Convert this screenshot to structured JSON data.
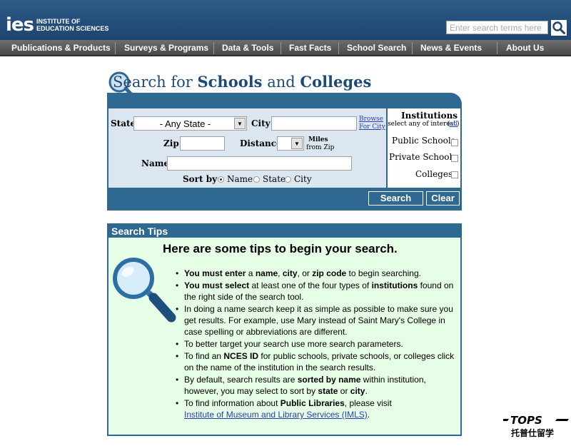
{
  "header": {
    "logo_mark": "ies",
    "logo_line1": "INSTITUTE of",
    "logo_line2": "EDUCATION SCIENCES",
    "search_placeholder": "Enter search terms here"
  },
  "nav": {
    "items": [
      {
        "label": "Publications & Products"
      },
      {
        "label": "Surveys & Programs"
      },
      {
        "label": "Data & Tools"
      },
      {
        "label": "Fast Facts"
      },
      {
        "label": "School Search"
      },
      {
        "label": "News & Events"
      },
      {
        "label": "About Us"
      }
    ]
  },
  "title": {
    "part1": "Search for ",
    "part2": "Schools",
    "part3": " and ",
    "part4": "Colleges"
  },
  "form": {
    "state_label": "State",
    "state_value": "- Any State -",
    "city_label": "City",
    "browse_line1": "Browse",
    "browse_line2": "For City",
    "zip_label": "Zip",
    "distance_label": "Distance",
    "miles_line1": "Miles",
    "miles_line2": "from Zip",
    "name_label": "Name",
    "sortby_label": "Sort by",
    "sort_options": [
      "Name",
      "State",
      "City"
    ],
    "sort_selected": "Name"
  },
  "institutions": {
    "title": "Institutions",
    "subtitle": "select any of interest",
    "all_link": "all",
    "options": [
      "Public Schools",
      "Private Schools",
      "Colleges"
    ]
  },
  "buttons": {
    "search": "Search",
    "clear": "Clear"
  },
  "tips": {
    "header": "Search Tips",
    "title": "Here are some tips to begin your search.",
    "items": [
      {
        "parts": [
          [
            "b",
            "You must enter"
          ],
          [
            "t",
            " a "
          ],
          [
            "b",
            "name"
          ],
          [
            "t",
            ", "
          ],
          [
            "b",
            "city"
          ],
          [
            "t",
            ", or "
          ],
          [
            "b",
            "zip code"
          ],
          [
            "t",
            " to begin searching."
          ]
        ]
      },
      {
        "parts": [
          [
            "b",
            "You must select"
          ],
          [
            "t",
            " at least one of the four types of "
          ],
          [
            "b",
            "institutions"
          ],
          [
            "t",
            " found on the right side of the search tool."
          ]
        ]
      },
      {
        "parts": [
          [
            "t",
            "In doing a name search keep it as simple as possible to make sure you get results. For example, use Mary instead of Saint Mary's College in case spelling or abbreviations are different."
          ]
        ]
      },
      {
        "parts": [
          [
            "t",
            "To better target your search use more search parameters."
          ]
        ]
      },
      {
        "parts": [
          [
            "t",
            "To find an "
          ],
          [
            "b",
            "NCES ID"
          ],
          [
            "t",
            " for public schools, private schools, or colleges click on the name of the institution in the search results."
          ]
        ]
      },
      {
        "parts": [
          [
            "t",
            "By default, search results are "
          ],
          [
            "b",
            "sorted by name"
          ],
          [
            "t",
            " within institution, however, you may select to sort by "
          ],
          [
            "b",
            "state"
          ],
          [
            "t",
            " or "
          ],
          [
            "b",
            "city"
          ],
          [
            "t",
            "."
          ]
        ]
      },
      {
        "parts": [
          [
            "t",
            "To find information about "
          ],
          [
            "b",
            "Public Libraries"
          ],
          [
            "t",
            ", please visit "
          ],
          [
            "br",
            ""
          ],
          [
            "a",
            "Institute of Museum and Library Services (IMLS)"
          ],
          [
            "t",
            "."
          ]
        ]
      }
    ]
  },
  "watermark": {
    "logo": "TOPS",
    "text": "托普仕留学"
  },
  "colors": {
    "header_blue": "#1d4570",
    "tool_blue": "#2f6891",
    "form_bg": "#dbe6f1",
    "tips_bg": "#e6fde6",
    "link": "#2a3fae"
  }
}
